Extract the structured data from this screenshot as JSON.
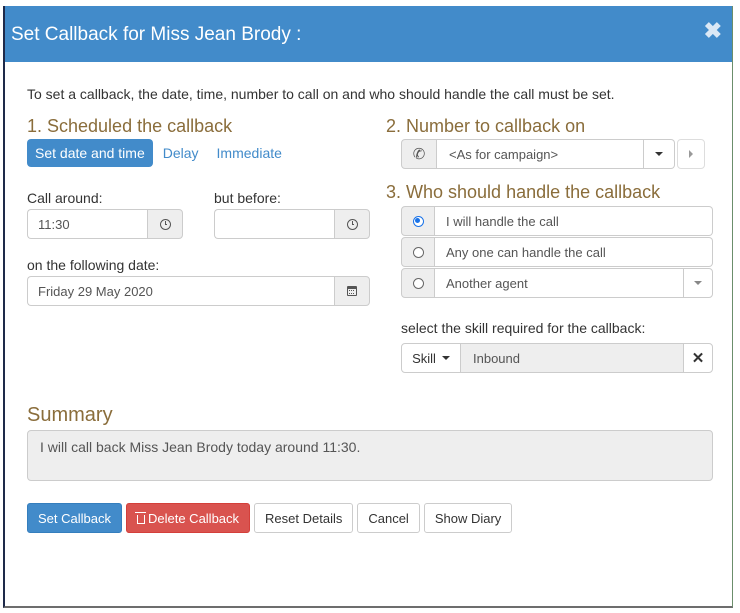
{
  "dialog": {
    "title": "Set Callback for Miss Jean Brody :",
    "close_icon": "close-icon",
    "intro": "To set a callback, the date, time, number to call on and who should handle the call must be set."
  },
  "schedule": {
    "title": "1. Scheduled the callback",
    "tabs": [
      {
        "label": "Set date and time",
        "active": true
      },
      {
        "label": "Delay",
        "active": false
      },
      {
        "label": "Immediate",
        "active": false
      }
    ],
    "call_around_label": "Call around:",
    "call_around_value": "11:30",
    "but_before_label": "but before:",
    "but_before_value": "",
    "date_label": "on the following date:",
    "date_value": "Friday 29 May 2020"
  },
  "number": {
    "title": "2. Number to callback on",
    "icon": "phone-icon",
    "selected": "<As for campaign>"
  },
  "handler": {
    "title": "3. Who should handle the callback",
    "options": [
      {
        "label": "I will handle the call",
        "checked": true
      },
      {
        "label": "Any one can handle the call",
        "checked": false
      },
      {
        "label": "Another agent",
        "checked": false
      }
    ],
    "skill_label": "select the skill required for the callback:",
    "skill_button": "Skill",
    "skill_value": "Inbound"
  },
  "summary": {
    "title": "Summary",
    "text": "I will call back Miss Jean Brody today around 11:30."
  },
  "buttons": {
    "set": "Set Callback",
    "delete": "Delete Callback",
    "reset": "Reset Details",
    "cancel": "Cancel",
    "diary": "Show Diary"
  },
  "colors": {
    "header": "#428bca",
    "section_title": "#8a6d3b",
    "danger": "#d9534f"
  }
}
